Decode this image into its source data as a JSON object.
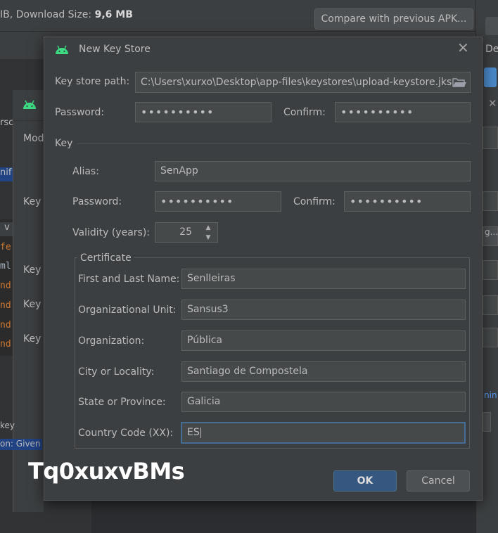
{
  "background": {
    "apk_info_size_label": "IB, Download Size: ",
    "apk_info_size_value": "9,6 MB",
    "compare_button": "Compare with previous APK...",
    "right_panel_de": "De",
    "right_panel_btn": "g...",
    "right_panel_link": "nin",
    "wizard_labels": [
      "Mod",
      "Key s",
      "Key s",
      "Key a",
      "Key p"
    ],
    "left_fragments": [
      "rsc",
      "nif"
    ],
    "code_lines": [
      "fe",
      "ml",
      "nd",
      "nd",
      "nd",
      "nd"
    ],
    "code_tab": "v",
    "bottom_key": "key",
    "bottom_selected": "on: Given"
  },
  "dialog": {
    "title": "New Key Store",
    "keystore_path_label": "Key store path:",
    "keystore_path_value": "C:\\Users\\xurxo\\Desktop\\app-files\\keystores\\upload-keystore.jks",
    "password_label": "Password:",
    "password_value": "••••••••••",
    "confirm_label": "Confirm:",
    "confirm_value": "••••••••••",
    "key_section": "Key",
    "alias_label": "Alias:",
    "alias_value": "SenApp",
    "key_password_label": "Password:",
    "key_password_value": "••••••••••",
    "key_confirm_label": "Confirm:",
    "key_confirm_value": "••••••••••",
    "validity_label": "Validity (years):",
    "validity_value": "25",
    "certificate_legend": "Certificate",
    "certificate": {
      "first_last_label": "First and Last Name:",
      "first_last_value": "SenlIeiras",
      "org_unit_label": "Organizational Unit:",
      "org_unit_value": "Sansus3",
      "org_label": "Organization:",
      "org_value": "Pública",
      "city_label": "City or Locality:",
      "city_value": "Santiago de Compostela",
      "state_label": "State or Province:",
      "state_value": "Galicia",
      "country_label": "Country Code (XX):",
      "country_value": "ES"
    },
    "ok_button": "OK",
    "cancel_button": "Cancel"
  },
  "watermark": "Tq0xuxvBMs",
  "colors": {
    "accent": "#365880",
    "android_green": "#3ddc84",
    "focus_border": "#466d94"
  }
}
